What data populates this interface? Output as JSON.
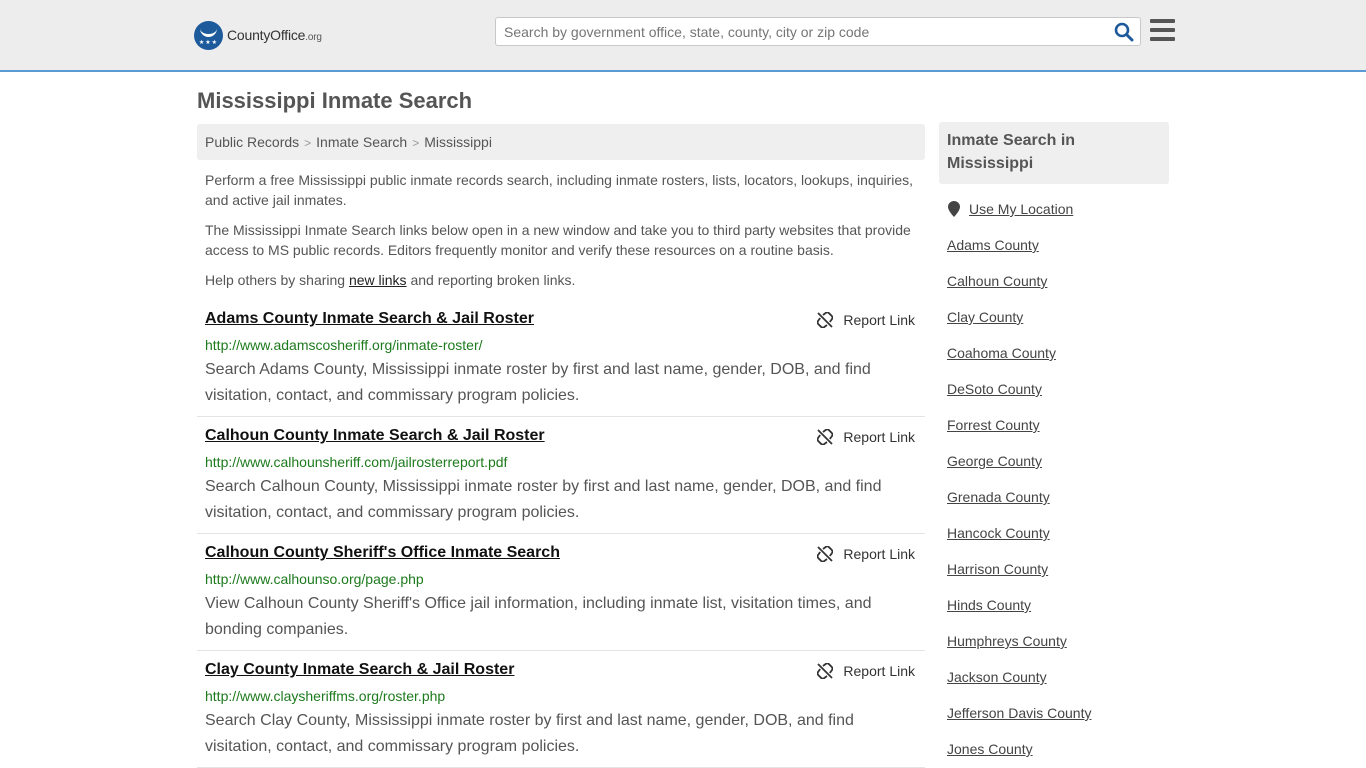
{
  "header": {
    "logo_main": "CountyOffice",
    "logo_suffix": ".org",
    "search_placeholder": "Search by government office, state, county, city or zip code"
  },
  "page": {
    "title": "Mississippi Inmate Search",
    "breadcrumb": [
      "Public Records",
      "Inmate Search",
      "Mississippi"
    ],
    "intro1": "Perform a free Mississippi public inmate records search, including inmate rosters, lists, locators, lookups, inquiries, and active jail inmates.",
    "intro2": "The Mississippi Inmate Search links below open in a new window and take you to third party websites that provide access to MS public records. Editors frequently monitor and verify these resources on a routine basis.",
    "intro3_before": "Help others by sharing ",
    "intro3_link": "new links",
    "intro3_after": " and reporting broken links."
  },
  "report_label": "Report Link",
  "listings": [
    {
      "title": "Adams County Inmate Search & Jail Roster",
      "url": "http://www.adamscosheriff.org/inmate-roster/",
      "desc": "Search Adams County, Mississippi inmate roster by first and last name, gender, DOB, and find visitation, contact, and commissary program policies."
    },
    {
      "title": "Calhoun County Inmate Search & Jail Roster",
      "url": "http://www.calhounsheriff.com/jailrosterreport.pdf",
      "desc": "Search Calhoun County, Mississippi inmate roster by first and last name, gender, DOB, and find visitation, contact, and commissary program policies."
    },
    {
      "title": "Calhoun County Sheriff's Office Inmate Search",
      "url": "http://www.calhounso.org/page.php",
      "desc": "View Calhoun County Sheriff's Office jail information, including inmate list, visitation times, and bonding companies."
    },
    {
      "title": "Clay County Inmate Search & Jail Roster",
      "url": "http://www.claysheriffms.org/roster.php",
      "desc": "Search Clay County, Mississippi inmate roster by first and last name, gender, DOB, and find visitation, contact, and commissary program policies."
    }
  ],
  "sidebar": {
    "heading": "Inmate Search in Mississippi",
    "use_location": "Use My Location",
    "counties": [
      "Adams County",
      "Calhoun County",
      "Clay County",
      "Coahoma County",
      "DeSoto County",
      "Forrest County",
      "George County",
      "Grenada County",
      "Hancock County",
      "Harrison County",
      "Hinds County",
      "Humphreys County",
      "Jackson County",
      "Jefferson Davis County",
      "Jones County"
    ]
  },
  "colors": {
    "header_bg": "#ededed",
    "header_border": "#5b9bd5",
    "logo_blue": "#1d5a9c",
    "search_icon": "#1d5a9c",
    "url_green": "#1d7a1d",
    "panel_bg": "#efefef"
  },
  "icons": {
    "search": "search-icon",
    "menu": "hamburger-menu-icon",
    "report": "broken-link-icon",
    "location": "map-pin-icon"
  }
}
